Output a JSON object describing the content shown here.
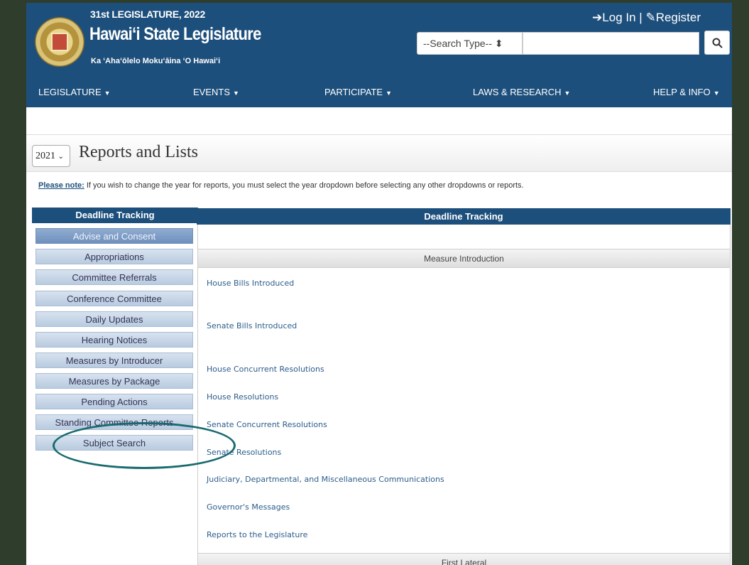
{
  "header": {
    "session": "31st LEGISLATURE, 2022",
    "name": "Hawai‘i State Legislature",
    "motto": "Ka ʻAhaʻōlelo Mokuʻāina ʻO Hawaiʻi",
    "login": "Log In",
    "separator": "|",
    "register": "Register",
    "search_type": "--Search Type-- ⬍",
    "search_placeholder": ""
  },
  "nav": [
    {
      "label": "LEGISLATURE"
    },
    {
      "label": "EVENTS"
    },
    {
      "label": "PARTICIPATE"
    },
    {
      "label": "LAWS & RESEARCH"
    },
    {
      "label": "HELP & INFO"
    }
  ],
  "page": {
    "year": "2021",
    "title": "Reports and Lists",
    "note_label": "Please note:",
    "note_text": " If you wish to change the year for reports, you must select the year dropdown before selecting any other dropdowns or reports."
  },
  "sidebar": {
    "heading": "Deadline Tracking",
    "items": [
      {
        "label": "Advise and Consent"
      },
      {
        "label": "Appropriations"
      },
      {
        "label": "Committee Referrals"
      },
      {
        "label": "Conference Committee"
      },
      {
        "label": "Daily Updates"
      },
      {
        "label": "Hearing Notices"
      },
      {
        "label": "Measures by Introducer"
      },
      {
        "label": "Measures by Package"
      },
      {
        "label": "Pending Actions"
      },
      {
        "label": "Standing Committee Reports"
      },
      {
        "label": "Subject Search"
      }
    ]
  },
  "panel": {
    "heading": "Deadline Tracking",
    "section1": "Measure Introduction",
    "links": [
      {
        "label": "House Bills Introduced"
      },
      {
        "label": "Senate Bills Introduced"
      },
      {
        "label": "House Concurrent Resolutions"
      },
      {
        "label": "House Resolutions"
      },
      {
        "label": "Senate Concurrent Resolutions"
      },
      {
        "label": "Senate Resolutions"
      },
      {
        "label": "Judiciary, Departmental, and Miscellaneous Communications"
      },
      {
        "label": "Governor's Messages"
      },
      {
        "label": "Reports to the Legislature"
      }
    ],
    "section2": "First Lateral"
  },
  "colors": {
    "brand": "#1d4f7c",
    "annotation": "#1a6b6f"
  }
}
